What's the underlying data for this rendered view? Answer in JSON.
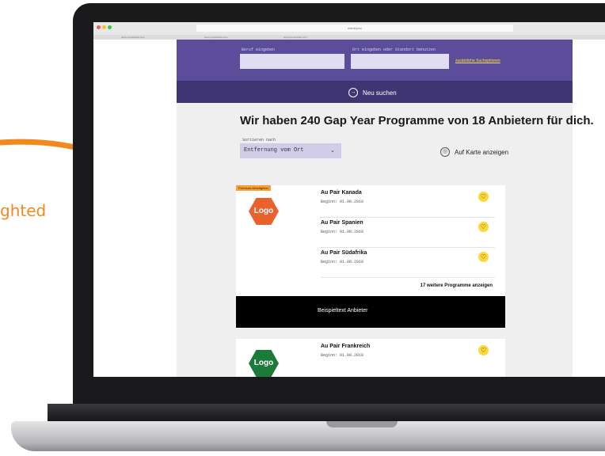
{
  "annotation": {
    "side_text": "ghted"
  },
  "browser": {
    "url": "meldejunc",
    "tabs": [
      "www.yourwebsite.com",
      "www.yourwebsite.com",
      "www.yourwebsite.com"
    ]
  },
  "search": {
    "beruf_label": "Beruf eingeben",
    "ort_label": "Ort eingeben oder Standort benutzen",
    "beruf_value": "",
    "ort_value": "",
    "more_options": "zusätzliche Suchoptionen",
    "new_search": "Neu suchen"
  },
  "results": {
    "headline": "Wir haben 240 Gap Year Programme von 18 Anbietern für dich.",
    "sort_label": "Sortieren nach",
    "sort_value": "Entfernung vom Ort",
    "map_link": "Auf Karte anzeigen"
  },
  "cards": [
    {
      "badge": "Premium-Arbeitgeber",
      "logo": "Logo",
      "logo_color": "#e8622e",
      "programs": [
        {
          "title": "Au Pair Kanada",
          "date": "Beginn: 01.08.2018"
        },
        {
          "title": "Au Pair Spanien",
          "date": "Beginn: 01.08.2018"
        },
        {
          "title": "Au Pair Südafrika",
          "date": "Beginn: 01.08.2018"
        }
      ],
      "more": "17 weitere Programme anzeigen",
      "footer": "Beispieltext Anbieter"
    },
    {
      "logo": "Logo",
      "logo_color": "#1c7a3a",
      "programs": [
        {
          "title": "Au Pair Frankreich",
          "date": "Beginn: 01.08.2018"
        }
      ]
    }
  ],
  "colors": {
    "accent": "#f08a1c",
    "hero": "#5b4d9a",
    "heart": "#fcd73a"
  }
}
